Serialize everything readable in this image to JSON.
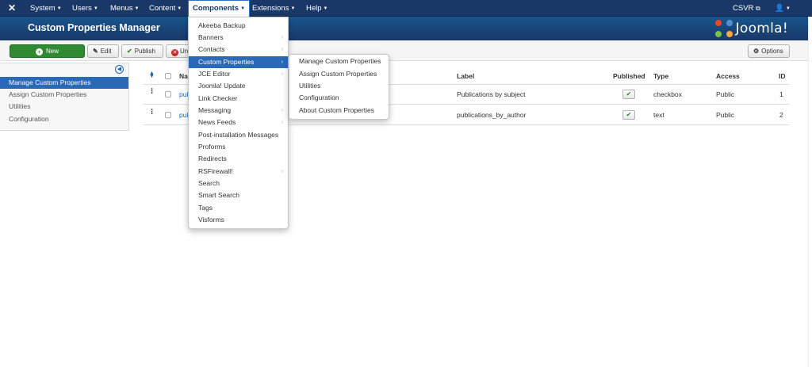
{
  "topnav": {
    "menus": [
      {
        "label": "System"
      },
      {
        "label": "Users"
      },
      {
        "label": "Menus"
      },
      {
        "label": "Content"
      },
      {
        "label": "Components"
      },
      {
        "label": "Extensions"
      },
      {
        "label": "Help"
      }
    ],
    "site_label": "CSVR",
    "site_icon": "external-link-icon",
    "user_icon": "user-icon"
  },
  "header": {
    "title": "Custom Properties Manager",
    "brand": "Joomla!"
  },
  "toolbar": {
    "new_label": "New",
    "edit_label": "Edit",
    "publish_label": "Publish",
    "unpublish_label": "Un",
    "options_label": "Options"
  },
  "sidebar": {
    "items": [
      {
        "label": "Manage Custom Properties"
      },
      {
        "label": "Assign Custom Properties"
      },
      {
        "label": "Utilities"
      },
      {
        "label": "Configuration"
      }
    ]
  },
  "table": {
    "headers": {
      "name": "Na",
      "label": "Label",
      "published": "Published",
      "type": "Type",
      "access": "Access",
      "id": "ID"
    },
    "rows": [
      {
        "name": "pul",
        "label": "Publications by subject",
        "published": "✔",
        "type": "checkbox",
        "access": "Public",
        "id": "1"
      },
      {
        "name": "pul",
        "label": "publications_by_author",
        "published": "✔",
        "type": "text",
        "access": "Public",
        "id": "2"
      }
    ]
  },
  "components_menu": {
    "items": [
      {
        "label": "Akeeba Backup",
        "arrow": ""
      },
      {
        "label": "Banners",
        "arrow": "›"
      },
      {
        "label": "Contacts",
        "arrow": "›"
      },
      {
        "label": "Custom Properties",
        "arrow": "›"
      },
      {
        "label": "JCE Editor",
        "arrow": "›"
      },
      {
        "label": "Joomla! Update",
        "arrow": ""
      },
      {
        "label": "Link Checker",
        "arrow": ""
      },
      {
        "label": "Messaging",
        "arrow": "›"
      },
      {
        "label": "News Feeds",
        "arrow": "›"
      },
      {
        "label": "Post-installation Messages",
        "arrow": ""
      },
      {
        "label": "Proforms",
        "arrow": ""
      },
      {
        "label": "Redirects",
        "arrow": ""
      },
      {
        "label": "RSFirewall!",
        "arrow": "›"
      },
      {
        "label": "Search",
        "arrow": ""
      },
      {
        "label": "Smart Search",
        "arrow": ""
      },
      {
        "label": "Tags",
        "arrow": ""
      },
      {
        "label": "Visforms",
        "arrow": ""
      }
    ]
  },
  "custom_properties_submenu": {
    "items": [
      {
        "label": "Manage Custom Properties"
      },
      {
        "label": "Assign Custom Properties"
      },
      {
        "label": "Utilities"
      },
      {
        "label": "Configuration"
      },
      {
        "label": "About Custom Properties"
      }
    ]
  },
  "colors": {
    "nav_bg": "#1a3867",
    "accent": "#2a69b8",
    "new_button": "#2f8a31"
  }
}
